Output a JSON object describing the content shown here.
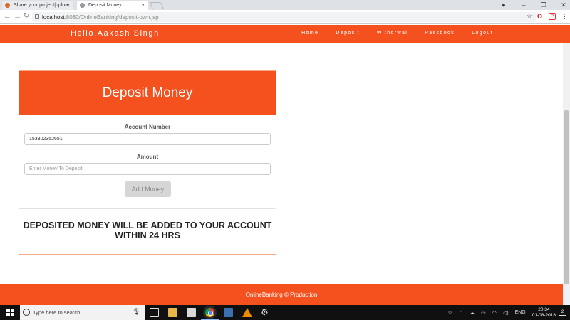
{
  "browser": {
    "tabs": [
      {
        "title": "Share your project|uploa",
        "active": false
      },
      {
        "title": "Deposit Money",
        "active": true
      }
    ],
    "url_host": "localhost",
    "url_path": ":8080/OnlineBanking/deposit-own.jsp",
    "ext_opera": "O",
    "ext_pocket": "P"
  },
  "navbar": {
    "greeting": "Hello,Aakash Singh",
    "links": [
      "Home",
      "Deposit",
      "Withdrwal",
      "Passbook",
      "Logout"
    ]
  },
  "card": {
    "title": "Deposit Money",
    "account_label": "Account Number",
    "account_value": "153302352651",
    "amount_label": "Amount",
    "amount_placeholder": "Enter Money To Deposit",
    "button_label": "Add Money",
    "notice_line1": "DEPOSITED MONEY WILL BE ADDED TO YOUR ACCOUNT",
    "notice_line2": "WITHIN 24 HRS"
  },
  "footer": {
    "text": "OnlineBanking © Production"
  },
  "taskbar": {
    "search_placeholder": "Type here to search",
    "language": "ENG",
    "time": "20:34",
    "date": "01-08-2018",
    "notifications": "2"
  },
  "colors": {
    "accent": "#f4511e",
    "border": "#f4a98a",
    "button_disabled": "#d6d6d6"
  }
}
